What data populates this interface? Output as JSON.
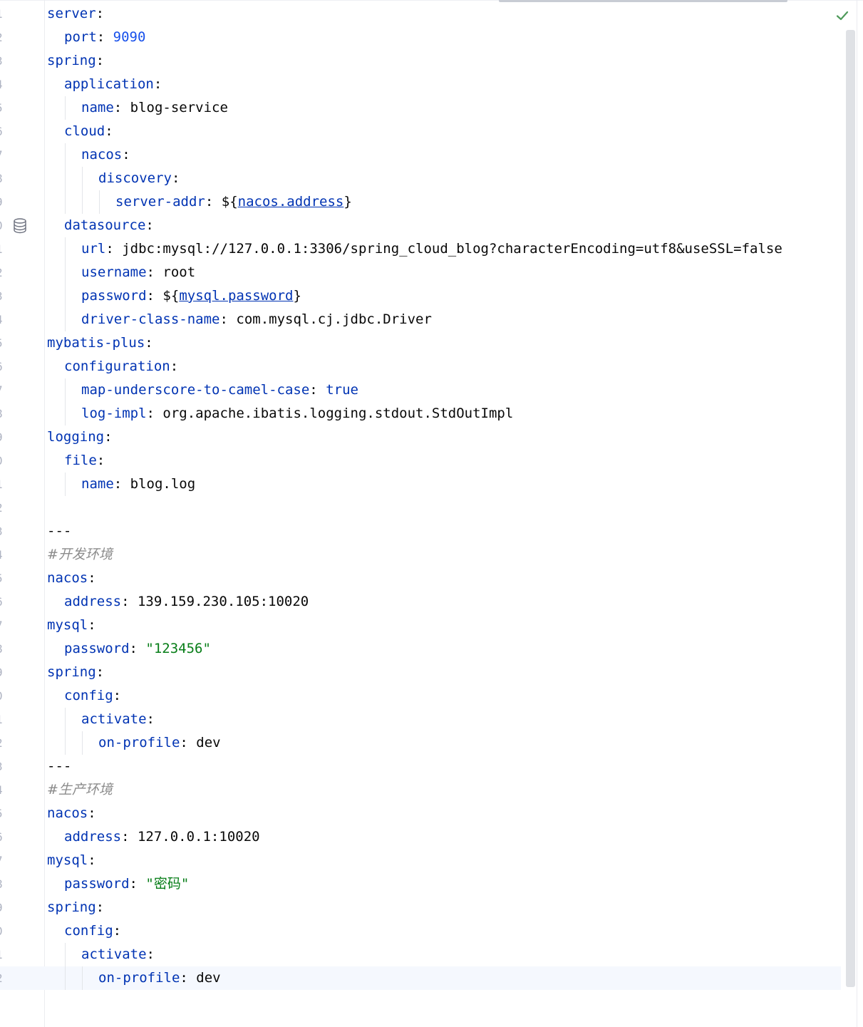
{
  "editor": {
    "file_type": "yaml",
    "inspection_status": "no-problems-check-icon",
    "gutter_icon_line": 10,
    "gutter_icon": "database-icon",
    "current_line": 42
  },
  "lines": [
    {
      "ln": "1",
      "indent": 0,
      "key": "server",
      "sep": ":",
      "value": "",
      "vtype": ""
    },
    {
      "ln": "2",
      "indent": 1,
      "key": "port",
      "sep": ":",
      "value": "9090",
      "vtype": "n"
    },
    {
      "ln": "3",
      "indent": 0,
      "key": "spring",
      "sep": ":",
      "value": "",
      "vtype": ""
    },
    {
      "ln": "4",
      "indent": 1,
      "key": "application",
      "sep": ":",
      "value": "",
      "vtype": ""
    },
    {
      "ln": "5",
      "indent": 2,
      "key": "name",
      "sep": ":",
      "value": "blog-service",
      "vtype": "c"
    },
    {
      "ln": "6",
      "indent": 1,
      "key": "cloud",
      "sep": ":",
      "value": "",
      "vtype": ""
    },
    {
      "ln": "7",
      "indent": 2,
      "key": "nacos",
      "sep": ":",
      "value": "",
      "vtype": ""
    },
    {
      "ln": "8",
      "indent": 3,
      "key": "discovery",
      "sep": ":",
      "value": "",
      "vtype": ""
    },
    {
      "ln": "9",
      "indent": 4,
      "key": "server-addr",
      "sep": ":",
      "value": "",
      "vtype": "ref",
      "pre": "${",
      "ref": "nacos.address",
      "post": "}"
    },
    {
      "ln": "0",
      "indent": 1,
      "key": "datasource",
      "sep": ":",
      "value": "",
      "vtype": ""
    },
    {
      "ln": "1",
      "indent": 2,
      "key": "url",
      "sep": ":",
      "value": "jdbc:mysql://127.0.0.1:3306/spring_cloud_blog?characterEncoding=utf8&useSSL=false",
      "vtype": "c"
    },
    {
      "ln": "2",
      "indent": 2,
      "key": "username",
      "sep": ":",
      "value": "root",
      "vtype": "c"
    },
    {
      "ln": "3",
      "indent": 2,
      "key": "password",
      "sep": ":",
      "value": "",
      "vtype": "ref",
      "pre": "${",
      "ref": "mysql.password",
      "post": "}"
    },
    {
      "ln": "4",
      "indent": 2,
      "key": "driver-class-name",
      "sep": ":",
      "value": "com.mysql.cj.jdbc.Driver",
      "vtype": "c"
    },
    {
      "ln": "5",
      "indent": 0,
      "key": "mybatis-plus",
      "sep": ":",
      "value": "",
      "vtype": ""
    },
    {
      "ln": "6",
      "indent": 1,
      "key": "configuration",
      "sep": ":",
      "value": "",
      "vtype": ""
    },
    {
      "ln": "7",
      "indent": 2,
      "key": "map-underscore-to-camel-case",
      "sep": ":",
      "value": "true",
      "vtype": "k"
    },
    {
      "ln": "8",
      "indent": 2,
      "key": "log-impl",
      "sep": ":",
      "value": "org.apache.ibatis.logging.stdout.StdOutImpl",
      "vtype": "c"
    },
    {
      "ln": "9",
      "indent": 0,
      "key": "logging",
      "sep": ":",
      "value": "",
      "vtype": ""
    },
    {
      "ln": "0",
      "indent": 1,
      "key": "file",
      "sep": ":",
      "value": "",
      "vtype": ""
    },
    {
      "ln": "1",
      "indent": 2,
      "key": "name",
      "sep": ":",
      "value": "blog.log",
      "vtype": "c"
    },
    {
      "ln": "2",
      "indent": 0,
      "key": "",
      "sep": "",
      "value": "",
      "vtype": ""
    },
    {
      "ln": "3",
      "indent": 0,
      "key": "",
      "sep": "",
      "value": "---",
      "vtype": "c"
    },
    {
      "ln": "4",
      "indent": 0,
      "key": "",
      "sep": "",
      "value": "#开发环境",
      "vtype": "cm"
    },
    {
      "ln": "5",
      "indent": 0,
      "key": "nacos",
      "sep": ":",
      "value": "",
      "vtype": ""
    },
    {
      "ln": "6",
      "indent": 1,
      "key": "address",
      "sep": ":",
      "value": "139.159.230.105:10020",
      "vtype": "c"
    },
    {
      "ln": "7",
      "indent": 0,
      "key": "mysql",
      "sep": ":",
      "value": "",
      "vtype": ""
    },
    {
      "ln": "8",
      "indent": 1,
      "key": "password",
      "sep": ":",
      "value": "\"123456\"",
      "vtype": "s"
    },
    {
      "ln": "9",
      "indent": 0,
      "key": "spring",
      "sep": ":",
      "value": "",
      "vtype": ""
    },
    {
      "ln": "0",
      "indent": 1,
      "key": "config",
      "sep": ":",
      "value": "",
      "vtype": ""
    },
    {
      "ln": "1",
      "indent": 2,
      "key": "activate",
      "sep": ":",
      "value": "",
      "vtype": ""
    },
    {
      "ln": "2",
      "indent": 3,
      "key": "on-profile",
      "sep": ":",
      "value": "dev",
      "vtype": "c"
    },
    {
      "ln": "3",
      "indent": 0,
      "key": "",
      "sep": "",
      "value": "---",
      "vtype": "c"
    },
    {
      "ln": "4",
      "indent": 0,
      "key": "",
      "sep": "",
      "value": "#生产环境",
      "vtype": "cm"
    },
    {
      "ln": "5",
      "indent": 0,
      "key": "nacos",
      "sep": ":",
      "value": "",
      "vtype": ""
    },
    {
      "ln": "6",
      "indent": 1,
      "key": "address",
      "sep": ":",
      "value": "127.0.0.1:10020",
      "vtype": "c"
    },
    {
      "ln": "7",
      "indent": 0,
      "key": "mysql",
      "sep": ":",
      "value": "",
      "vtype": ""
    },
    {
      "ln": "8",
      "indent": 1,
      "key": "password",
      "sep": ":",
      "value": "\"密码\"",
      "vtype": "s"
    },
    {
      "ln": "9",
      "indent": 0,
      "key": "spring",
      "sep": ":",
      "value": "",
      "vtype": ""
    },
    {
      "ln": "0",
      "indent": 1,
      "key": "config",
      "sep": ":",
      "value": "",
      "vtype": ""
    },
    {
      "ln": "1",
      "indent": 2,
      "key": "activate",
      "sep": ":",
      "value": "",
      "vtype": ""
    },
    {
      "ln": "2",
      "indent": 3,
      "key": "on-profile",
      "sep": ":",
      "value": "dev",
      "vtype": "c"
    }
  ]
}
